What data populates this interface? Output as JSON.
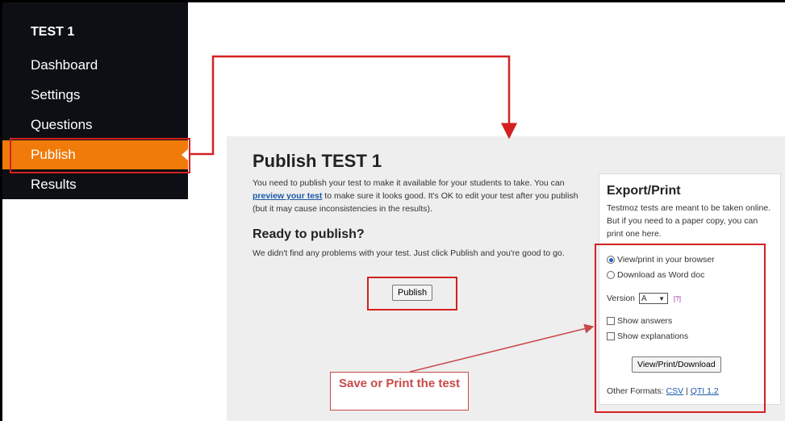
{
  "sidebar": {
    "title": "TEST 1",
    "items": [
      {
        "label": "Dashboard"
      },
      {
        "label": "Settings"
      },
      {
        "label": "Questions"
      },
      {
        "label": "Publish"
      },
      {
        "label": "Results"
      }
    ]
  },
  "main": {
    "title": "Publish TEST 1",
    "intro_pre": "You need to publish your test to make it available for your students to take. You can ",
    "intro_link": "preview your test",
    "intro_post": " to make sure it looks good. It's OK to edit your test after you publish (but it may cause inconsistencies in the results).",
    "ready_heading": "Ready to publish?",
    "ready_text": "We didn't find any problems with your test. Just click Publish and you're good to go.",
    "publish_button": "Publish"
  },
  "export": {
    "title": "Export/Print",
    "description": "Testmoz tests are meant to be taken online. But if you need to a paper copy, you can print one here.",
    "option_view": "View/print in your browser",
    "option_download": "Download as Word doc",
    "version_label": "Version",
    "version_value": "A",
    "help": "[?]",
    "show_answers": "Show answers",
    "show_explanations": "Show explanations",
    "action_button": "View/Print/Download",
    "other_formats_label": "Other Formats:",
    "format_csv": "CSV",
    "format_sep": "|",
    "format_qti": "QTI 1.2"
  },
  "annotation": {
    "callout": "Save or Print the test",
    "color": "#d42020"
  }
}
